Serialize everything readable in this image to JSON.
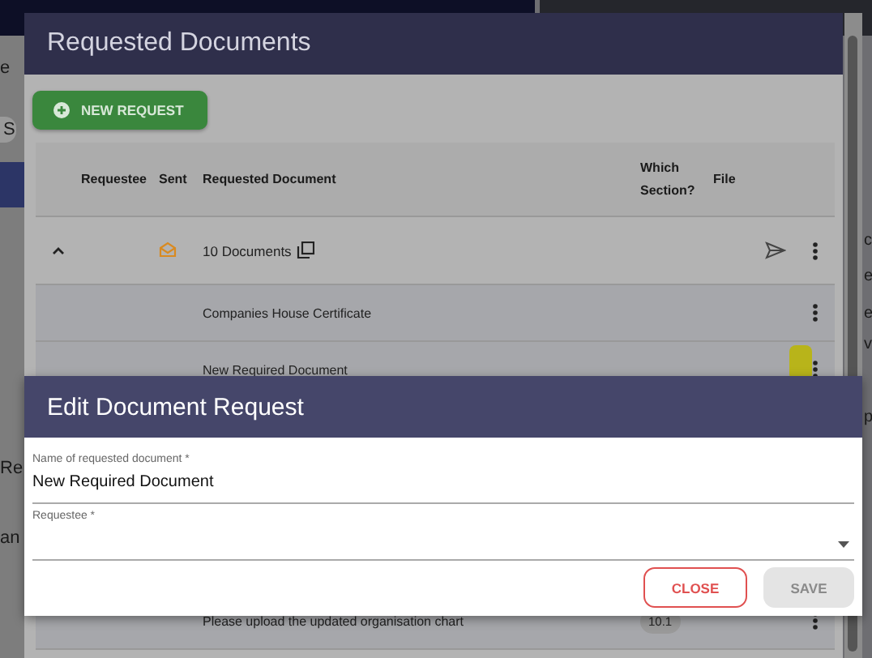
{
  "background": {
    "fragments_left": [
      {
        "text": "e",
        "kind": "plain"
      },
      {
        "text": "S",
        "kind": "pill"
      },
      {
        "text": "Re",
        "kind": "plain"
      },
      {
        "text": "an",
        "kind": "plain"
      }
    ],
    "fragments_right": [
      "c",
      "e",
      "e",
      "v",
      "p"
    ]
  },
  "documents_dialog": {
    "title": "Requested Documents",
    "new_request_button": "NEW REQUEST",
    "columns": [
      "Requestee",
      "Sent",
      "Requested Document",
      "Which Section?",
      "File"
    ],
    "group": {
      "expanded": true,
      "sent": true,
      "title": "10 Documents"
    },
    "rows": [
      {
        "document": "Companies House Certificate",
        "highlighted": false
      },
      {
        "document": "New Required Document",
        "highlighted": true
      },
      {
        "document": "Please upload the updated organisation chart",
        "section": "10.1",
        "highlighted": false
      }
    ]
  },
  "edit_dialog": {
    "title": "Edit Document Request",
    "fields": [
      {
        "label": "Name of requested document *",
        "value": "New Required Document",
        "kind": "text"
      },
      {
        "label": "Requestee *",
        "kind": "select"
      }
    ],
    "buttons": [
      {
        "label": "CLOSE",
        "kind": "outline",
        "disabled": false
      },
      {
        "label": "SAVE",
        "kind": "filled",
        "disabled": true
      }
    ]
  }
}
